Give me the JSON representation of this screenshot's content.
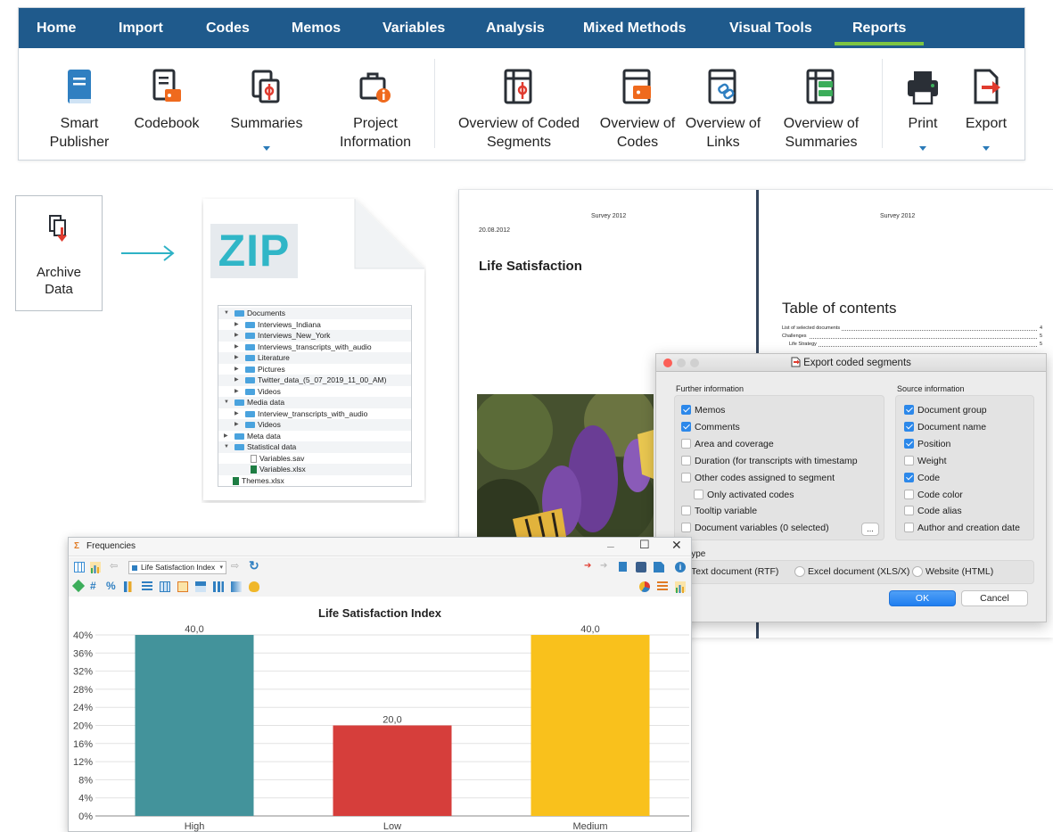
{
  "ribbon": {
    "tabs": [
      "Home",
      "Import",
      "Codes",
      "Memos",
      "Variables",
      "Analysis",
      "Mixed Methods",
      "Visual Tools",
      "Reports"
    ],
    "active_tab": "Reports",
    "buttons": [
      {
        "line1": "Smart",
        "line2": "Publisher",
        "icon": "book-icon"
      },
      {
        "line1": "Codebook",
        "line2": "",
        "icon": "codebook-icon"
      },
      {
        "line1": "Summaries",
        "line2": "",
        "icon": "summaries-icon"
      },
      {
        "line1": "Project",
        "line2": "Information",
        "icon": "project-info-icon"
      },
      {
        "line1": "Overview of Coded",
        "line2": "Segments",
        "icon": "coded-segments-table-icon"
      },
      {
        "line1": "Overview of",
        "line2": "Codes",
        "icon": "codes-table-icon"
      },
      {
        "line1": "Overview of",
        "line2": "Links",
        "icon": "links-table-icon"
      },
      {
        "line1": "Overview of",
        "line2": "Summaries",
        "icon": "summaries-table-icon"
      },
      {
        "line1": "Print",
        "line2": "",
        "icon": "printer-icon"
      },
      {
        "line1": "Export",
        "line2": "",
        "icon": "export-icon"
      }
    ]
  },
  "archive": {
    "line1": "Archive",
    "line2": "Data"
  },
  "zip": {
    "label": "ZIP",
    "tree": [
      "Documents",
      "Interviews_Indiana",
      "Interviews_New_York",
      "Interviews_transcripts_with_audio",
      "Literature",
      "Pictures",
      "Twitter_data_(5_07_2019_11_00_AM)",
      "Videos",
      "Media data",
      "Interview_transcripts_with_audio",
      "Videos",
      "Meta data",
      "Statistical data",
      "Variables.sav",
      "Variables.xlsx",
      "Themes.xlsx"
    ]
  },
  "report": {
    "left_header": "Survey 2012",
    "right_header": "Survey 2012",
    "date": "20.08.2012",
    "doc_title": "Life Satisfaction",
    "toc_title": "Table of contents",
    "toc": [
      {
        "text": "List of selected documents",
        "page": "4"
      },
      {
        "text": "Challenges",
        "page": "5"
      },
      {
        "text": "Life Strategy",
        "page": "5"
      }
    ]
  },
  "export_dialog": {
    "title": "Export coded segments",
    "further_heading": "Further information",
    "further": [
      {
        "label": "Memos",
        "checked": true
      },
      {
        "label": "Comments",
        "checked": true
      },
      {
        "label": "Area and coverage",
        "checked": false
      },
      {
        "label": "Duration (for transcripts with timestamp",
        "checked": false
      },
      {
        "label": "Other codes assigned to segment",
        "checked": false
      },
      {
        "label": "Only activated codes",
        "checked": false
      },
      {
        "label": "Tooltip variable",
        "checked": false
      },
      {
        "label": "Document variables (0 selected)",
        "checked": false
      }
    ],
    "more_label": "...",
    "source_heading": "Source information",
    "source": [
      {
        "label": "Document group",
        "checked": true
      },
      {
        "label": "Document name",
        "checked": true
      },
      {
        "label": "Position",
        "checked": true
      },
      {
        "label": "Weight",
        "checked": false
      },
      {
        "label": "Code",
        "checked": true
      },
      {
        "label": "Code color",
        "checked": false
      },
      {
        "label": "Code alias",
        "checked": false
      },
      {
        "label": "Author and creation date",
        "checked": false
      }
    ],
    "export_type_heading": "ort type",
    "export_types": [
      "Text document (RTF)",
      "Excel document (XLS/X)",
      "Website (HTML)"
    ],
    "ok": "OK",
    "cancel": "Cancel"
  },
  "frequencies": {
    "window_title": "Frequencies",
    "variable": "Life Satisfaction Index",
    "colors": {
      "High": "#43939b",
      "Low": "#d63e3b",
      "Medium": "#f9c11c"
    }
  },
  "chart_data": {
    "type": "bar",
    "title": "Life Satisfaction Index",
    "categories": [
      "High",
      "Low",
      "Medium"
    ],
    "values": [
      40.0,
      20.0,
      40.0
    ],
    "value_labels": [
      "40,0",
      "20,0",
      "40,0"
    ],
    "yticks": [
      "0%",
      "4%",
      "8%",
      "12%",
      "16%",
      "20%",
      "24%",
      "28%",
      "32%",
      "36%",
      "40%"
    ],
    "ylim": [
      0,
      40
    ],
    "grid": true,
    "xlabel": "",
    "ylabel": ""
  }
}
